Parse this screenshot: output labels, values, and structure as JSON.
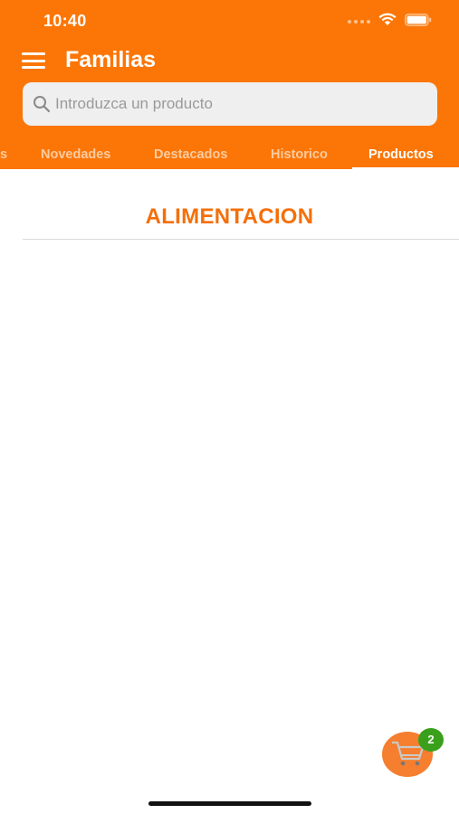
{
  "status_bar": {
    "time": "10:40",
    "icons": [
      "signal-icon",
      "wifi-icon",
      "battery-icon"
    ]
  },
  "header": {
    "title": "Familias",
    "menu_icon": "hamburger-menu-icon",
    "background_color": "#fb7607"
  },
  "search": {
    "placeholder": "Introduzca un producto",
    "value": "",
    "icon": "search-icon"
  },
  "tabs": [
    {
      "label": "s",
      "active": false
    },
    {
      "label": "Novedades",
      "active": false
    },
    {
      "label": "Destacados",
      "active": false
    },
    {
      "label": "Historico",
      "active": false
    },
    {
      "label": "Productos",
      "active": true
    }
  ],
  "main": {
    "section_title": "ALIMENTACION",
    "accent_color": "#f46f0a"
  },
  "cart": {
    "icon": "shopping-cart-icon",
    "badge_count": "2",
    "badge_color": "#3aa01b"
  }
}
